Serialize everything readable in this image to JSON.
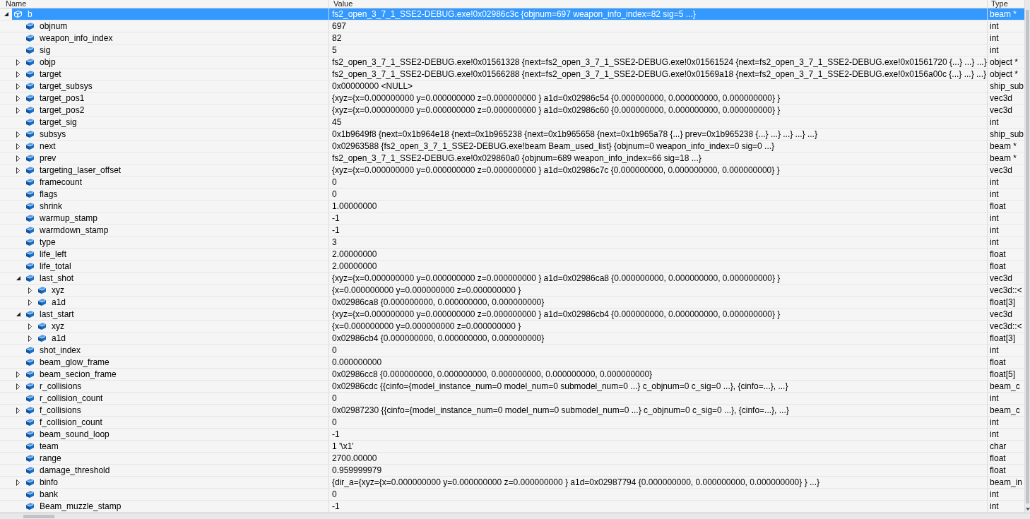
{
  "columns": [
    "Name",
    "Value",
    "Type"
  ],
  "rows": [
    {
      "name": "b",
      "value": "fs2_open_3_7_1_SSE2-DEBUG.exe!0x02986c3c {objnum=697 weapon_info_index=82 sig=5 ...}",
      "type": "beam *",
      "selected": true,
      "expanded": true,
      "children": [
        {
          "name": "objnum",
          "value": "697",
          "type": "int",
          "selected": false
        },
        {
          "name": "weapon_info_index",
          "value": "82",
          "type": "int",
          "selected": false
        },
        {
          "name": "sig",
          "value": "5",
          "type": "int",
          "selected": false
        },
        {
          "name": "objp",
          "value": "fs2_open_3_7_1_SSE2-DEBUG.exe!0x01561328 {next=fs2_open_3_7_1_SSE2-DEBUG.exe!0x01561524 {next=fs2_open_3_7_1_SSE2-DEBUG.exe!0x01561720 {...} ...} ...}",
          "type": "object *",
          "selected": false,
          "expanded": false
        },
        {
          "name": "target",
          "value": "fs2_open_3_7_1_SSE2-DEBUG.exe!0x01566288 {next=fs2_open_3_7_1_SSE2-DEBUG.exe!0x01569a18 {next=fs2_open_3_7_1_SSE2-DEBUG.exe!0x0156a00c {...} ...} ...}",
          "type": "object *",
          "selected": false,
          "expanded": false
        },
        {
          "name": "target_subsys",
          "value": "0x00000000 <NULL>",
          "type": "ship_sub",
          "selected": false,
          "expanded": false
        },
        {
          "name": "target_pos1",
          "value": "{xyz={x=0.000000000 y=0.000000000 z=0.000000000 } a1d=0x02986c54 {0.000000000, 0.000000000, 0.000000000} }",
          "type": "vec3d",
          "selected": false,
          "expanded": false
        },
        {
          "name": "target_pos2",
          "value": "{xyz={x=0.000000000 y=0.000000000 z=0.000000000 } a1d=0x02986c60 {0.000000000, 0.000000000, 0.000000000} }",
          "type": "vec3d",
          "selected": false,
          "expanded": false
        },
        {
          "name": "target_sig",
          "value": "45",
          "type": "int",
          "selected": false
        },
        {
          "name": "subsys",
          "value": "0x1b9649f8 {next=0x1b964e18 {next=0x1b965238 {next=0x1b965658 {next=0x1b965a78 {...} prev=0x1b965238 {...} ...} ...} ...} ...}",
          "type": "ship_sub",
          "selected": false,
          "expanded": false
        },
        {
          "name": "next",
          "value": "0x02963588 {fs2_open_3_7_1_SSE2-DEBUG.exe!beam Beam_used_list} {objnum=0 weapon_info_index=0 sig=0 ...}",
          "type": "beam *",
          "selected": false,
          "expanded": false
        },
        {
          "name": "prev",
          "value": "fs2_open_3_7_1_SSE2-DEBUG.exe!0x029860a0 {objnum=689 weapon_info_index=66 sig=18 ...}",
          "type": "beam *",
          "selected": false,
          "expanded": false
        },
        {
          "name": "targeting_laser_offset",
          "value": "{xyz={x=0.000000000 y=0.000000000 z=0.000000000 } a1d=0x02986c7c {0.000000000, 0.000000000, 0.000000000} }",
          "type": "vec3d",
          "selected": false,
          "expanded": false
        },
        {
          "name": "framecount",
          "value": "0",
          "type": "int",
          "selected": false
        },
        {
          "name": "flags",
          "value": "0",
          "type": "int",
          "selected": false
        },
        {
          "name": "shrink",
          "value": "1.00000000",
          "type": "float",
          "selected": false
        },
        {
          "name": "warmup_stamp",
          "value": "-1",
          "type": "int",
          "selected": false
        },
        {
          "name": "warmdown_stamp",
          "value": "-1",
          "type": "int",
          "selected": false
        },
        {
          "name": "type",
          "value": "3",
          "type": "int",
          "selected": false
        },
        {
          "name": "life_left",
          "value": "2.00000000",
          "type": "float",
          "selected": false
        },
        {
          "name": "life_total",
          "value": "2.00000000",
          "type": "float",
          "selected": false
        },
        {
          "name": "last_shot",
          "value": "{xyz={x=0.000000000 y=0.000000000 z=0.000000000 } a1d=0x02986ca8 {0.000000000, 0.000000000, 0.000000000} }",
          "type": "vec3d",
          "selected": false,
          "expanded": true,
          "children": [
            {
              "name": "xyz",
              "value": "{x=0.000000000 y=0.000000000 z=0.000000000 }",
              "type": "vec3d::<",
              "selected": false,
              "expanded": false
            },
            {
              "name": "a1d",
              "value": "0x02986ca8 {0.000000000, 0.000000000, 0.000000000}",
              "type": "float[3]",
              "selected": false,
              "expanded": false
            }
          ]
        },
        {
          "name": "last_start",
          "value": "{xyz={x=0.000000000 y=0.000000000 z=0.000000000 } a1d=0x02986cb4 {0.000000000, 0.000000000, 0.000000000} }",
          "type": "vec3d",
          "selected": false,
          "expanded": true,
          "children": [
            {
              "name": "xyz",
              "value": "{x=0.000000000 y=0.000000000 z=0.000000000 }",
              "type": "vec3d::<",
              "selected": false,
              "expanded": false
            },
            {
              "name": "a1d",
              "value": "0x02986cb4 {0.000000000, 0.000000000, 0.000000000}",
              "type": "float[3]",
              "selected": false,
              "expanded": false
            }
          ]
        },
        {
          "name": "shot_index",
          "value": "0",
          "type": "int",
          "selected": false
        },
        {
          "name": "beam_glow_frame",
          "value": "0.000000000",
          "type": "float",
          "selected": false
        },
        {
          "name": "beam_secion_frame",
          "value": "0x02986cc8 {0.000000000, 0.000000000, 0.000000000, 0.000000000, 0.000000000}",
          "type": "float[5]",
          "selected": false,
          "expanded": false
        },
        {
          "name": "r_collisions",
          "value": "0x02986cdc {{cinfo={model_instance_num=0 model_num=0 submodel_num=0 ...} c_objnum=0 c_sig=0 ...}, {cinfo=...}, ...}",
          "type": "beam_c",
          "selected": false,
          "expanded": false
        },
        {
          "name": "r_collision_count",
          "value": "0",
          "type": "int",
          "selected": false
        },
        {
          "name": "f_collisions",
          "value": "0x02987230 {{cinfo={model_instance_num=0 model_num=0 submodel_num=0 ...} c_objnum=0 c_sig=0 ...}, {cinfo=...}, ...}",
          "type": "beam_c",
          "selected": false,
          "expanded": false
        },
        {
          "name": "f_collision_count",
          "value": "0",
          "type": "int",
          "selected": false
        },
        {
          "name": "beam_sound_loop",
          "value": "-1",
          "type": "int",
          "selected": false
        },
        {
          "name": "team",
          "value": "1 '\\x1'",
          "type": "char",
          "selected": false
        },
        {
          "name": "range",
          "value": "2700.00000",
          "type": "float",
          "selected": false
        },
        {
          "name": "damage_threshold",
          "value": "0.959999979",
          "type": "float",
          "selected": false
        },
        {
          "name": "binfo",
          "value": "{dir_a={xyz={x=0.000000000 y=0.000000000 z=0.000000000 } a1d=0x02987794 {0.000000000, 0.000000000, 0.000000000} } ...}",
          "type": "beam_in",
          "selected": false,
          "expanded": false
        },
        {
          "name": "bank",
          "value": "0",
          "type": "int",
          "selected": false
        },
        {
          "name": "Beam_muzzle_stamp",
          "value": "-1",
          "type": "int",
          "selected": false
        }
      ]
    }
  ]
}
